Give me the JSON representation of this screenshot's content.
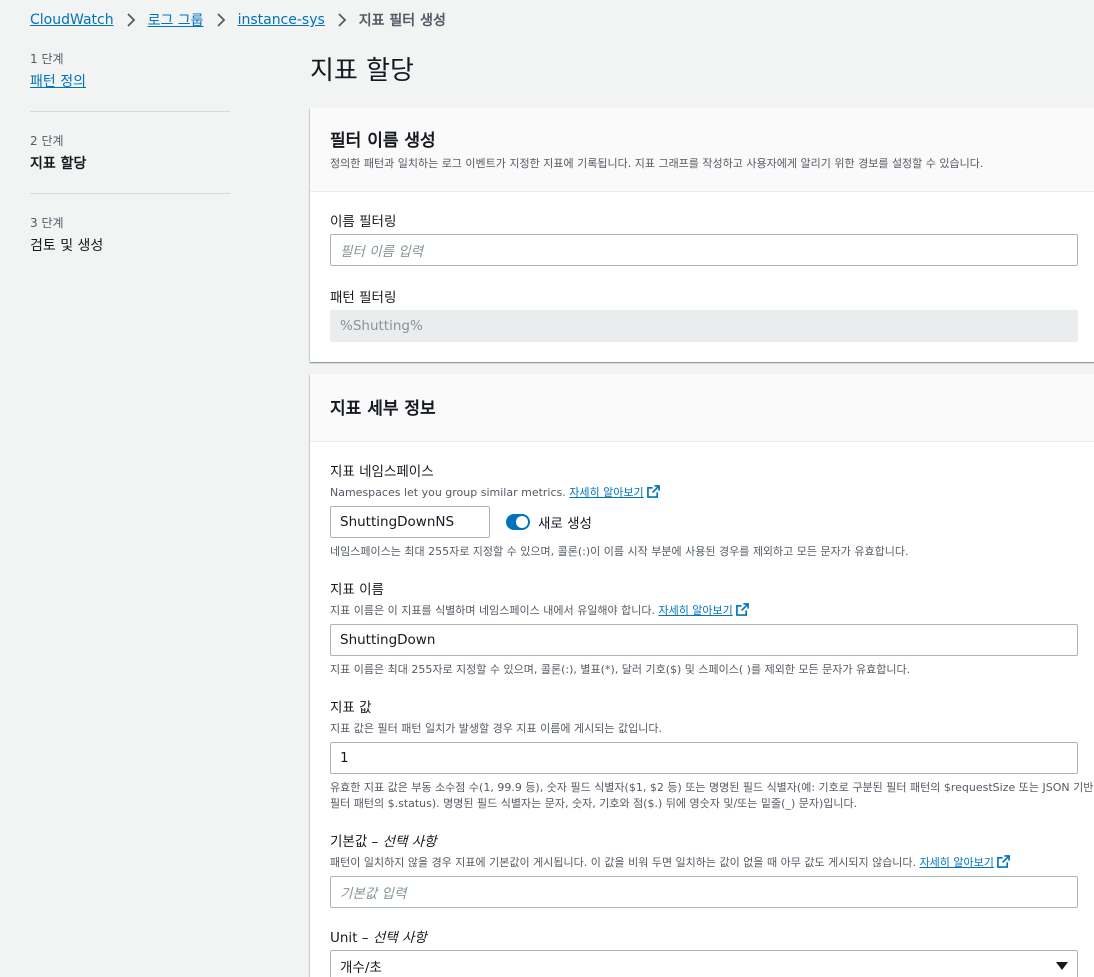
{
  "breadcrumb": [
    {
      "label": "CloudWatch"
    },
    {
      "label": "로그 그룹"
    },
    {
      "label": "instance-sys"
    },
    {
      "label": "지표 필터 생성"
    }
  ],
  "steps": [
    {
      "num": "1 단계",
      "label": "패턴 정의"
    },
    {
      "num": "2 단계",
      "label": "지표 할당"
    },
    {
      "num": "3 단계",
      "label": "검토 및 생성"
    }
  ],
  "page": {
    "title": "지표 할당"
  },
  "filter_card": {
    "title": "필터 이름 생성",
    "desc": "정의한 패턴과 일치하는 로그 이벤트가 지정한 지표에 기록됩니다. 지표 그래프를 작성하고 사용자에게 알리기 위한 경보를 설정할 수 있습니다.",
    "name_label": "이름 필터링",
    "name_placeholder": "필터 이름 입력",
    "pattern_label": "패턴 필터링",
    "pattern_value": "%Shutting%"
  },
  "metric_card": {
    "title": "지표 세부 정보",
    "namespace": {
      "label": "지표 네임스페이스",
      "desc": "Namespaces let you group similar metrics.",
      "learn_more": "자세히 알아보기",
      "value": "ShuttingDownNS",
      "toggle_label": "새로 생성",
      "hint": "네임스페이스는 최대 255자로 지정할 수 있으며, 콜론(:)이 이름 시작 부분에 사용된 경우를 제외하고 모든 문자가 유효합니다."
    },
    "metric_name": {
      "label": "지표 이름",
      "desc": "지표 이름은 이 지표를 식별하며 네임스페이스 내에서 유일해야 합니다.",
      "learn_more": "자세히 알아보기",
      "value": "ShuttingDown",
      "hint": "지표 이름은 최대 255자로 지정할 수 있으며, 콜론(:), 별표(*), 달러 기호($) 및 스페이스( )를 제외한 모든 문자가 유효합니다."
    },
    "metric_value": {
      "label": "지표 값",
      "desc": "지표 값은 필터 패턴 일치가 발생할 경우 지표 이름에 게시되는 값입니다.",
      "value": "1",
      "hint": "유효한 지표 값은 부동 소수점 수(1, 99.9 등), 숫자 필드 식별자($1, $2 등) 또는 명명된 필드 식별자(예: 기호로 구분된 필터 패턴의 $requestSize 또는 JSON 기반 필터 패턴의 $.status). 명명된 필드 식별자는 문자, 숫자, 기호와 점($.) 뒤에 영숫자 및/또는 밑줄(_) 문자)입니다."
    },
    "default_value": {
      "label": "기본값",
      "optional": "선택 사항",
      "desc": "패턴이 일치하지 않을 경우 지표에 기본값이 게시됩니다. 이 값을 비워 두면 일치하는 값이 없을 때 아무 값도 게시되지 않습니다.",
      "learn_more": "자세히 알아보기",
      "placeholder": "기본값 입력"
    },
    "unit": {
      "label": "Unit",
      "optional": "선택 사항",
      "value": "개수/초"
    }
  },
  "colors": {
    "link": "#0073bb",
    "toggle": "#0073bb",
    "background": "#f2f3f3"
  }
}
